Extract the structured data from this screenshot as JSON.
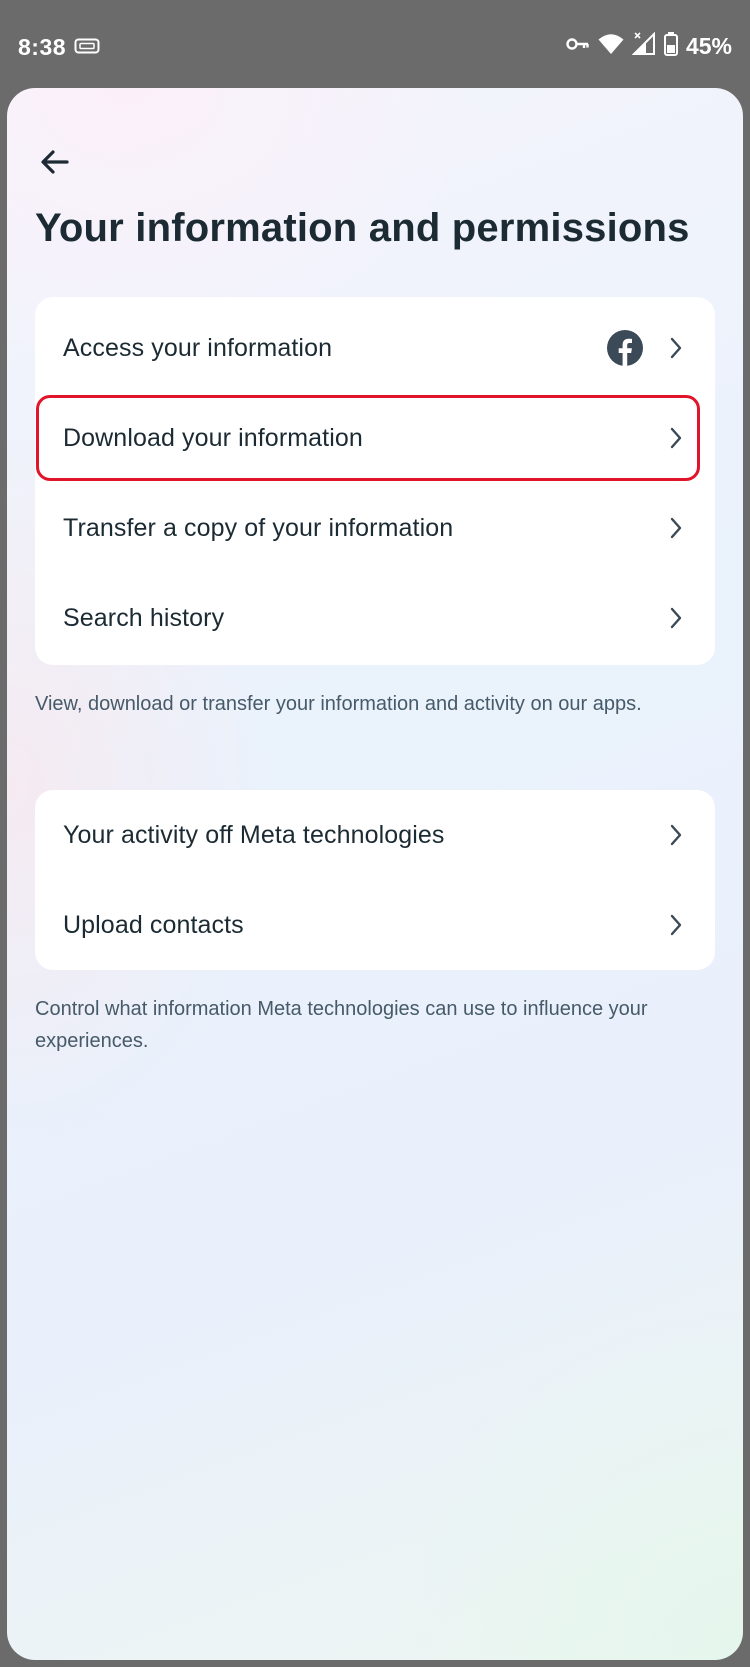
{
  "status_bar": {
    "time": "8:38",
    "battery": "45%"
  },
  "header": {
    "title": "Your information and permissions"
  },
  "section1": {
    "items": [
      {
        "label": "Access your information",
        "icon": "facebook-icon"
      },
      {
        "label": "Download your information",
        "highlighted": true
      },
      {
        "label": "Transfer a copy of your information"
      },
      {
        "label": "Search history"
      }
    ],
    "caption": "View, download or transfer your information and activity on our apps."
  },
  "section2": {
    "items": [
      {
        "label": "Your activity off Meta technologies"
      },
      {
        "label": "Upload contacts"
      }
    ],
    "caption": "Control what information Meta technologies can use to influence your experiences."
  },
  "colors": {
    "highlight": "#e0142a",
    "text": "#1c2b33",
    "caption": "#465a69",
    "icon": "#3b4a56"
  }
}
